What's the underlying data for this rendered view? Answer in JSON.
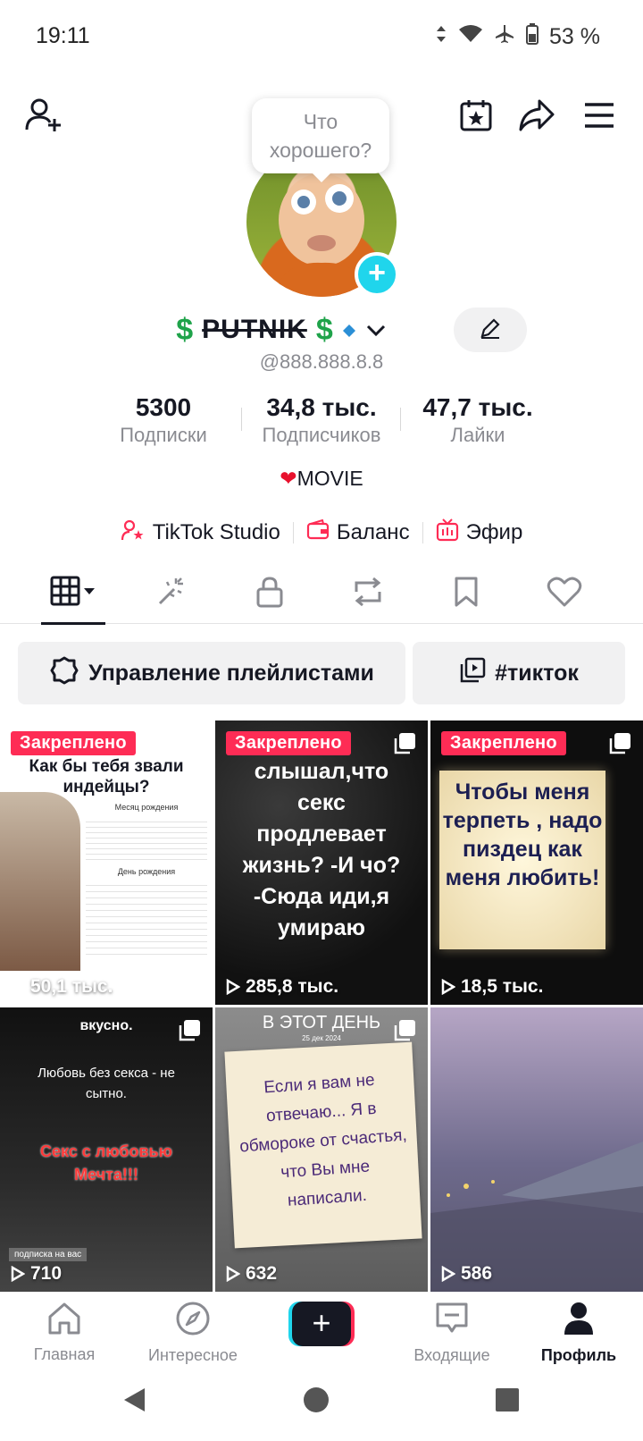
{
  "status": {
    "time": "19:11",
    "battery": "53 %"
  },
  "profile": {
    "bubble": "Что хорошего?",
    "dollar": "$",
    "name": "PUTNIK",
    "username": "@888.888.8.8",
    "bio": "MOVIE"
  },
  "stats": [
    {
      "value": "5300",
      "label": "Подписки"
    },
    {
      "value": "34,8 тыс.",
      "label": "Подписчиков"
    },
    {
      "value": "47,7 тыс.",
      "label": "Лайки"
    }
  ],
  "links": {
    "studio": "TikTok Studio",
    "balance": "Баланс",
    "live": "Эфир"
  },
  "chips": {
    "playlists": "Управление плейлистами",
    "tag": "#тикток"
  },
  "videos": [
    {
      "pinned": "Закреплено",
      "views": "50,1 тыс.",
      "caption": "Как бы тебя звали индейцы?",
      "sub1": "Месяц рождения",
      "sub2": "День рождения"
    },
    {
      "pinned": "Закреплено",
      "views": "285,8 тыс.",
      "caption": "слышал,что секс продлевает жизнь? -И чо? -Сюда иди,я умираю"
    },
    {
      "pinned": "Закреплено",
      "views": "18,5 тыс.",
      "caption": "Чтобы меня терпеть , надо пиздец как меня любить!"
    },
    {
      "views": "710",
      "caption_top": "вкусно.",
      "caption": "Любовь без секса - не сытно.",
      "caption_red": "Секс с любовью Мечта!!!",
      "tag": "подписка на вас"
    },
    {
      "views": "632",
      "caption_top": "В ЭТОТ ДЕНЬ",
      "date": "25 дек 2024",
      "caption": "Если я вам не отвечаю... Я в обмороке от счастья, что Вы мне написали."
    },
    {
      "views": "586"
    }
  ],
  "nav": {
    "home": "Главная",
    "explore": "Интересное",
    "inbox": "Входящие",
    "profile": "Профиль"
  },
  "colors": {
    "accent": "#fe2c55",
    "cyan": "#20d5ec",
    "dollar": "#1fa34a"
  }
}
